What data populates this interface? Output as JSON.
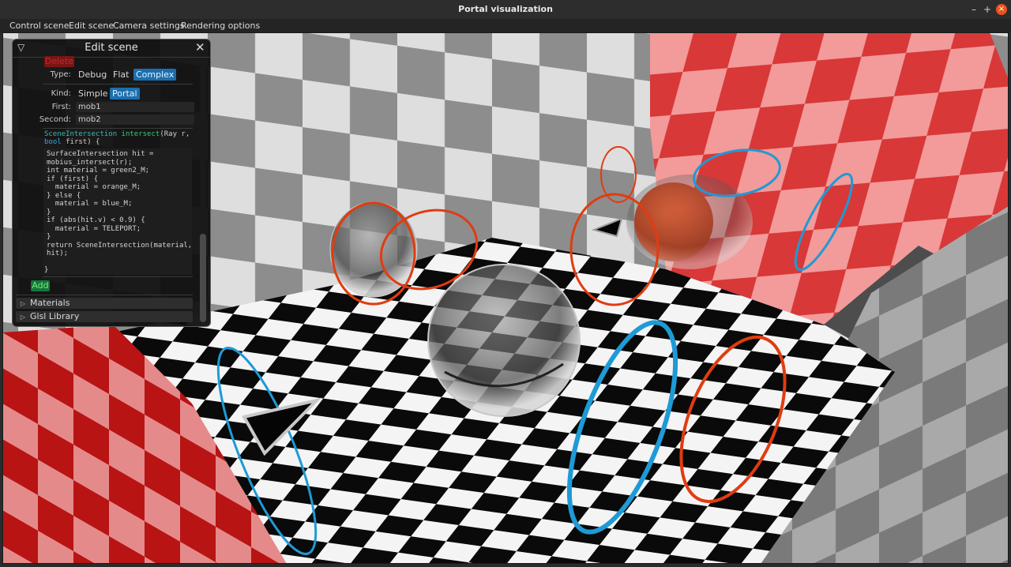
{
  "window": {
    "title": "Portal visualization",
    "min": "–",
    "max": "+",
    "close": "×"
  },
  "menu": [
    "Control scene",
    "Edit scene",
    "Camera settings",
    "Rendering options"
  ],
  "panel": {
    "title": "Edit scene",
    "collapse_icon": "▽",
    "close_icon": "✕",
    "delete_label": "Delete",
    "type": {
      "label": "Type:",
      "options": [
        "Debug",
        "Flat",
        "Complex"
      ],
      "selected": "Complex"
    },
    "kind": {
      "label": "Kind:",
      "options": [
        "Simple",
        "Portal"
      ],
      "selected": "Portal"
    },
    "first": {
      "label": "First:",
      "value": "mob1"
    },
    "second": {
      "label": "Second:",
      "value": "mob2"
    },
    "code_signature": {
      "type": "SceneIntersection",
      "fn": "intersect",
      "args_line1": "(Ray r,",
      "kw": "bool",
      "args_line2": " first) {"
    },
    "code_body": "SurfaceIntersection hit =\nmobius_intersect(r);\nint material = green2_M;\nif (first) {\n  material = orange_M;\n} else {\n  material = blue_M;\n}\nif (abs(hit.v) < 0.9) {\n  material = TELEPORT;\n}\nreturn SceneIntersection(material,\nhit);",
    "code_close": "}",
    "add_label": "Add",
    "sections": [
      "Materials",
      "Glsl Library"
    ]
  },
  "colors": {
    "accent_blue": "#1b6fad",
    "portal_orange": "#e03c10",
    "portal_blue": "#1e9ad6",
    "checker_red": "#c8161c"
  }
}
